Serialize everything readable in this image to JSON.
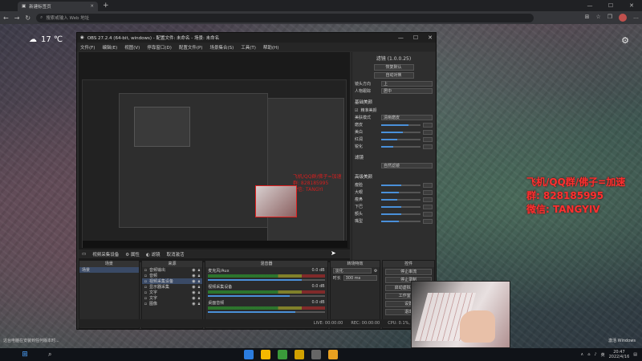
{
  "browser": {
    "tab_title": "新建标签页",
    "url_placeholder": "搜索或输入 Web 地址"
  },
  "weather": {
    "temp": "17 ℃"
  },
  "obs": {
    "title": "OBS 27.2.4 (64-bit, windows) - 配置文件: 未命名 - 场景: 未命名",
    "menu": [
      "文件(F)",
      "编辑(E)",
      "视图(V)",
      "停靠窗口(D)",
      "配置文件(P)",
      "场景集合(S)",
      "工具(T)",
      "帮助(H)"
    ],
    "props_header": "滤镜 (1.0.0.25)",
    "props_buttons": [
      "恢复默认",
      "自动对焦"
    ],
    "props_rows": [
      {
        "label": "镜头方向",
        "value": "上"
      },
      {
        "label": "人物跟踪",
        "value": "居中"
      }
    ],
    "section_basic": "基础美颜",
    "basic_toggle": "精准美颜",
    "beauty_mode_label": "美肤模式",
    "beauty_mode_value": "清晰磨皮",
    "basic_sliders": [
      {
        "label": "磨皮",
        "level": 0.7
      },
      {
        "label": "美白",
        "level": 0.55
      },
      {
        "label": "红润",
        "level": 0.4
      },
      {
        "label": "锐化",
        "level": 0.3
      }
    ],
    "section_filter": "滤镜",
    "filter_value": "自然滤镜",
    "section_advanced": "高级美颜",
    "advanced_sliders": [
      {
        "label": "瘦脸",
        "level": 0.5
      },
      {
        "label": "大眼",
        "level": 0.45
      },
      {
        "label": "瘦鼻",
        "level": 0.4
      },
      {
        "label": "下巴",
        "level": 0.5
      },
      {
        "label": "额头",
        "level": 0.5
      },
      {
        "label": "嘴型",
        "level": 0.45
      }
    ],
    "source_toolbar": [
      "视频采集设备",
      "属性",
      "滤镜",
      "取消激活"
    ],
    "docks": {
      "scenes_title": "场景",
      "scenes": [
        "场景"
      ],
      "sources_title": "来源",
      "sources": [
        "音频输出",
        "音频",
        "视频采集设备",
        "显示器采集",
        "文字",
        "文字",
        "图像"
      ],
      "mixer_title": "混音器",
      "mixer": [
        {
          "name": "麦克风/Aux",
          "db": "0.0 dB",
          "level": 0.8
        },
        {
          "name": "视频采集设备",
          "db": "0.0 dB",
          "level": 0.7
        },
        {
          "name": "桌面音频",
          "db": "0.0 dB",
          "level": 0.75
        }
      ],
      "transitions_title": "转场特效",
      "transition_value": "淡化",
      "duration_label": "时长",
      "duration_value": "300 ms",
      "controls_title": "控件",
      "controls": [
        "停止串流",
        "停止录制",
        "启动虚拟摄像机",
        "工作室模式",
        "设置",
        "退出"
      ]
    },
    "status": [
      "LIVE: 00:00:00",
      "REC: 00:00:00",
      "CPU: 0.1%, 30.00 fps"
    ]
  },
  "overlay": {
    "line1": "飞机/QQ群/佛子=加速",
    "line2": "群: 828185995",
    "line3": "微信: TANGYIV"
  },
  "nested_overlay": [
    "飞机/QQ群/佛子=加速",
    "群: 828185995",
    "微信: TANGYI"
  ],
  "desktop": {
    "left_note": "这台电脑在安装到任何版本时...",
    "right_note": "激活 Windows"
  },
  "taskbar": {
    "time": "20:47",
    "date": "2022/4/16",
    "lang": "英",
    "app_colors": [
      "#2b7de0",
      "#f5b800",
      "#3a9a3a",
      "#d0a000",
      "#666666",
      "#e8a020"
    ]
  }
}
